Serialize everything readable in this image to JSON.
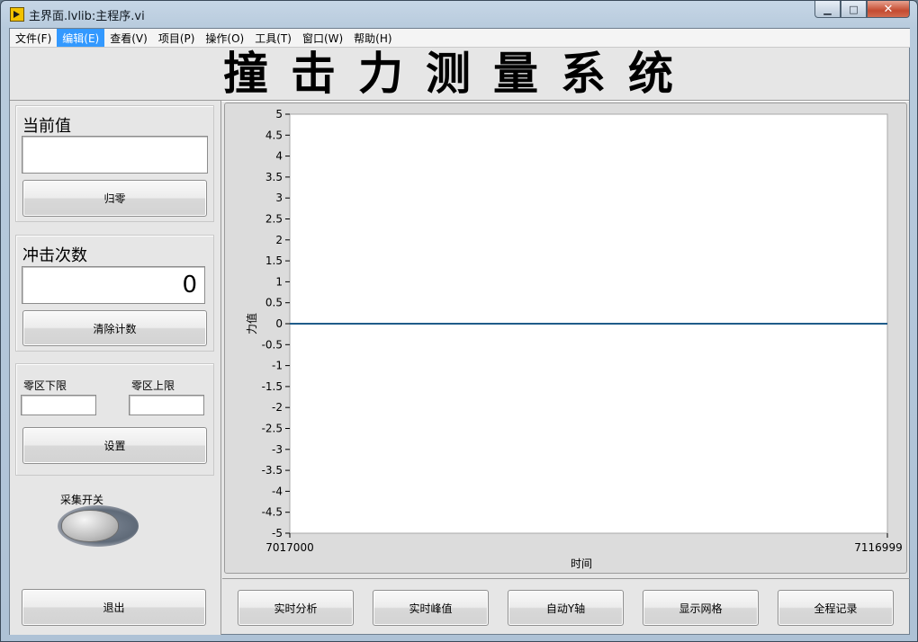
{
  "window": {
    "title": "主界面.lvlib:主程序.vi"
  },
  "window_buttons": {
    "minimize": "▁",
    "maximize": "□",
    "close": "✕"
  },
  "menu": [
    "文件(F)",
    "编辑(E)",
    "查看(V)",
    "项目(P)",
    "操作(O)",
    "工具(T)",
    "窗口(W)",
    "帮助(H)"
  ],
  "menu_active_index": 1,
  "header": {
    "title": "撞击力测量系统"
  },
  "current_value": {
    "label": "当前值",
    "value": "",
    "zero_button": "归零"
  },
  "impact_count": {
    "label": "冲击次数",
    "value": "0",
    "clear_button": "清除计数"
  },
  "zero_zone": {
    "lower_label": "零区下限",
    "lower_value": "",
    "upper_label": "零区上限",
    "upper_value": "",
    "set_button": "设置"
  },
  "acquisition": {
    "label": "采集开关",
    "state": "off"
  },
  "exit_button": "退出",
  "bottom_buttons": [
    "实时分析",
    "实时峰值",
    "自动Y轴",
    "显示网格",
    "全程记录"
  ],
  "chart_data": {
    "type": "line",
    "xlabel": "时间",
    "ylabel": "力值",
    "xlim": [
      7017000,
      7116999
    ],
    "ylim": [
      -5,
      5
    ],
    "x_tick_labels": [
      "7017000",
      "7116999"
    ],
    "y_tick_labels": [
      "5",
      "4.5",
      "4",
      "3.5",
      "3",
      "2.5",
      "2",
      "1.5",
      "1",
      "0.5",
      "0",
      "-0.5",
      "-1",
      "-1.5",
      "-2",
      "-2.5",
      "-3",
      "-3.5",
      "-4",
      "-4.5",
      "-5"
    ],
    "series": [
      {
        "x": [
          7017000,
          7116999
        ],
        "y": [
          0,
          0
        ],
        "color": "#1f5c8a"
      }
    ],
    "grid": false
  }
}
